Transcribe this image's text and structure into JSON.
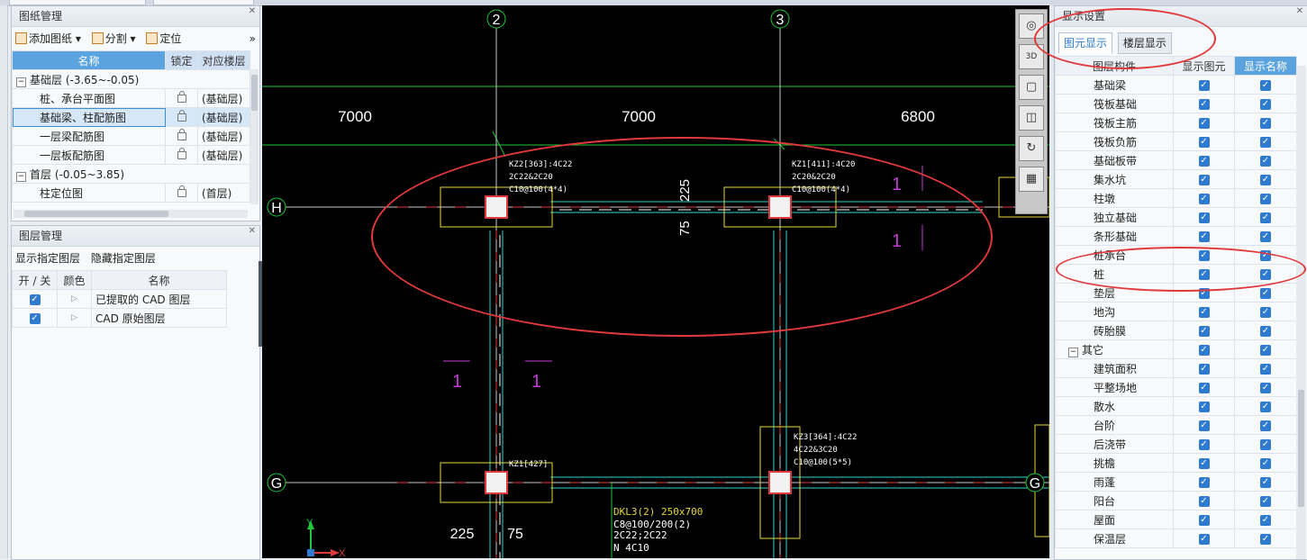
{
  "drawing_panel": {
    "title": "图纸管理",
    "toolbar": {
      "add": "添加图纸",
      "split": "分割",
      "locate": "定位"
    },
    "columns": [
      "名称",
      "锁定",
      "对应楼层"
    ],
    "rows": [
      {
        "type": "group",
        "name": "基础层 (-3.65~-0.05)"
      },
      {
        "type": "item",
        "name": "桩、承台平面图",
        "floor": "(基础层)"
      },
      {
        "type": "item",
        "name": "基础梁、柱配筋图",
        "floor": "(基础层)",
        "selected": true
      },
      {
        "type": "item",
        "name": "一层梁配筋图",
        "floor": "(基础层)"
      },
      {
        "type": "item",
        "name": "一层板配筋图",
        "floor": "(基础层)"
      },
      {
        "type": "group",
        "name": "首层 (-0.05~3.85)"
      },
      {
        "type": "item",
        "name": "柱定位图",
        "floor": "(首层)"
      }
    ]
  },
  "layer_panel": {
    "title": "图层管理",
    "show_btn": "显示指定图层",
    "hide_btn": "隐藏指定图层",
    "columns": [
      "开 / 关",
      "颜色",
      "名称"
    ],
    "rows": [
      {
        "name": "已提取的 CAD 图层",
        "on": true
      },
      {
        "name": "CAD 原始图层",
        "on": true
      }
    ]
  },
  "display_panel": {
    "title": "显示设置",
    "tabs": [
      "图元显示",
      "楼层显示"
    ],
    "columns": [
      "图层构件",
      "显示图元",
      "显示名称"
    ],
    "rows": [
      {
        "name": "基础梁"
      },
      {
        "name": "筏板基础"
      },
      {
        "name": "筏板主筋"
      },
      {
        "name": "筏板负筋"
      },
      {
        "name": "基础板带"
      },
      {
        "name": "集水坑"
      },
      {
        "name": "柱墩"
      },
      {
        "name": "独立基础"
      },
      {
        "name": "条形基础"
      },
      {
        "name": "桩承台"
      },
      {
        "name": "桩"
      },
      {
        "name": "垫层"
      },
      {
        "name": "地沟"
      },
      {
        "name": "砖胎膜"
      },
      {
        "name": "其它",
        "group": true
      },
      {
        "name": "建筑面积"
      },
      {
        "name": "平整场地"
      },
      {
        "name": "散水"
      },
      {
        "name": "台阶"
      },
      {
        "name": "后浇带"
      },
      {
        "name": "挑檐"
      },
      {
        "name": "雨蓬"
      },
      {
        "name": "阳台"
      },
      {
        "name": "屋面"
      },
      {
        "name": "保温层"
      }
    ]
  },
  "cad": {
    "axes": {
      "col2": "2",
      "col3": "3",
      "rowH": "H",
      "rowG": "G"
    },
    "dims": {
      "d1": "7000",
      "d2": "7000",
      "d3": "6800",
      "v225": "225",
      "v75": "75",
      "b225": "225",
      "b75": "75"
    },
    "section_marks": {
      "s1": "1",
      "s2": "1",
      "s3": "1",
      "s4": "1"
    },
    "kz2": [
      "KZ2[363]:4C22",
      "2C22&2C20",
      "C10@100(4*4)"
    ],
    "kz1a": [
      "KZ1[411]:4C20",
      "2C20&2C20",
      "C10@100(4*4)"
    ],
    "kz1b": [
      "KZ1[427]"
    ],
    "kz3": [
      "KZ3[364]:4C22",
      "4C22&3C20",
      "C10@100(5*5)"
    ],
    "beam": [
      "DKL3(2) 250x700",
      "C8@100/200(2)",
      "2C22;2C22",
      "N 4C10"
    ],
    "ucs": {
      "y": "Y",
      "x": "X"
    }
  },
  "view_tools": [
    "3D"
  ],
  "colors": {
    "annotation": "#e0393c",
    "accent": "#2f7bd0",
    "cad_bg": "#000000"
  }
}
